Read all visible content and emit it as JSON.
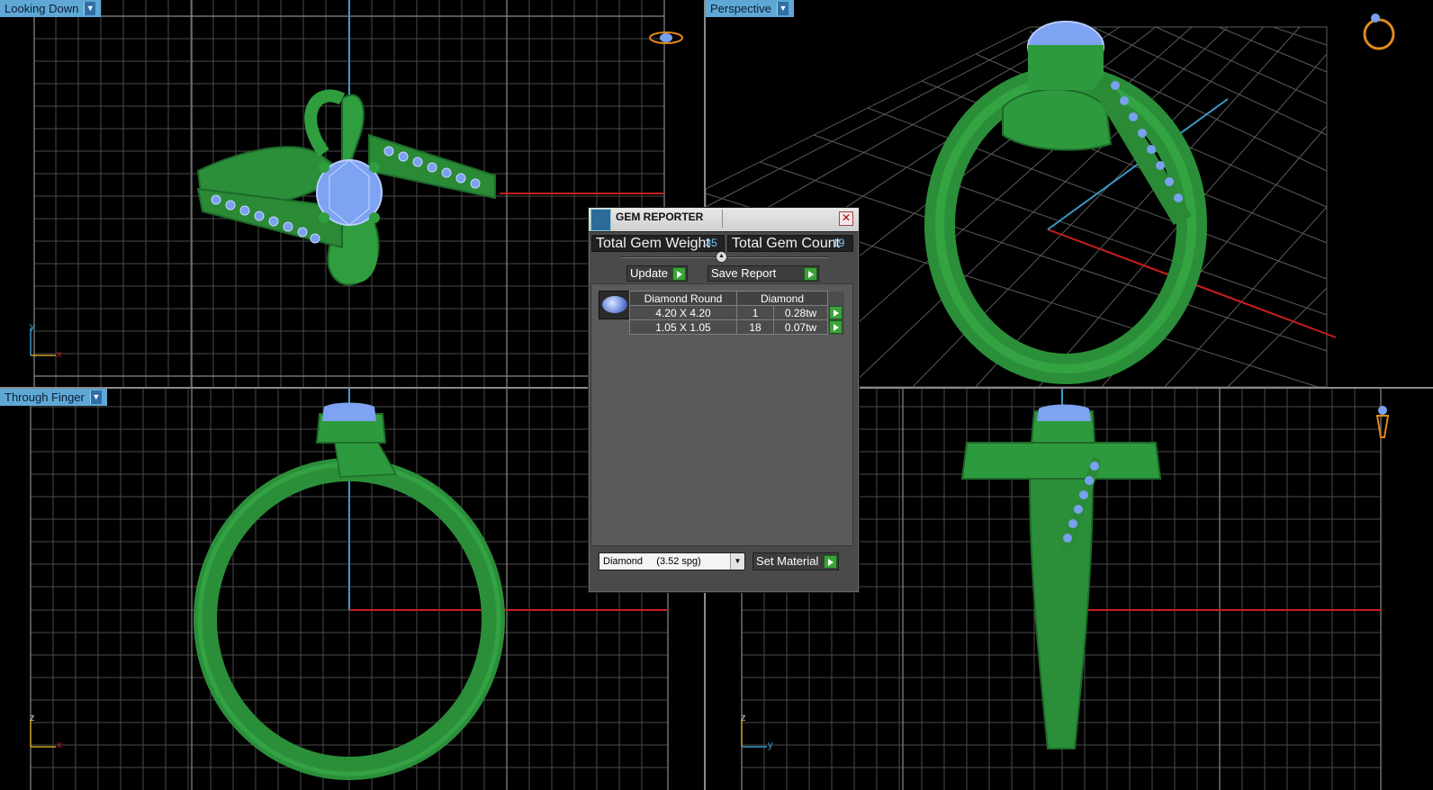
{
  "viewports": {
    "top_left": {
      "label": "Looking Down",
      "axes": [
        "y",
        "x"
      ]
    },
    "top_right": {
      "label": "Perspective"
    },
    "bottom_left": {
      "label": "Through Finger",
      "axes": [
        "z",
        "x"
      ]
    },
    "bottom_right": {
      "label": "",
      "axes": [
        "z",
        "y"
      ]
    }
  },
  "dialog": {
    "title": "GEM REPORTER",
    "total_weight_label": "Total Gem Weight",
    "total_weight_value": ".35",
    "total_count_label": "Total Gem Count",
    "total_count_value": "19",
    "update_label": "Update",
    "save_report_label": "Save Report",
    "table": {
      "headers": [
        "Diamond Round",
        "Diamond"
      ],
      "rows": [
        {
          "size": "4.20 X 4.20",
          "count": "1",
          "weight": "0.28tw"
        },
        {
          "size": "1.05 X 1.05",
          "count": "18",
          "weight": "0.07tw"
        }
      ]
    },
    "material_select": {
      "value": "Diamond     (3.52 spg)"
    },
    "set_material_label": "Set Material"
  },
  "colors": {
    "grid": "#5a5a5a",
    "metal": "#2e9a3e",
    "gem": "#7aa0f0",
    "axis_x": "#c81e1e",
    "axis_y": "#3a9ac8",
    "label_bg": "#5fa8d6"
  }
}
